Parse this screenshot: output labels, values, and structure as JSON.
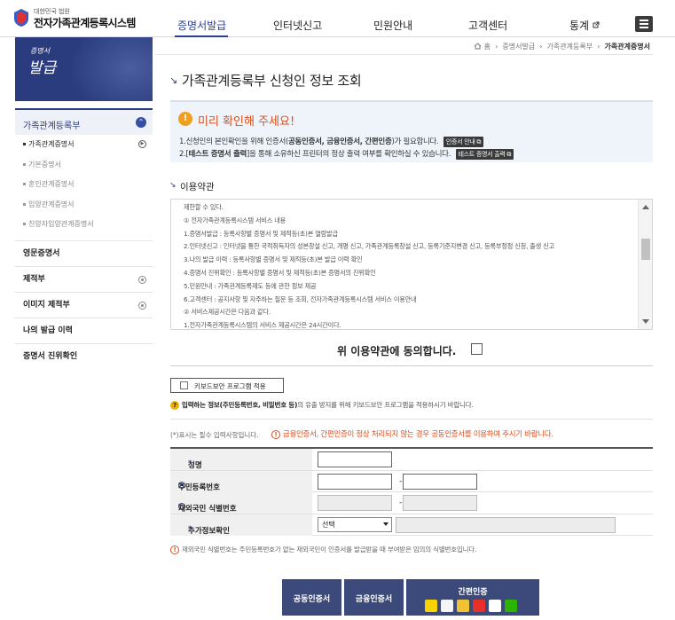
{
  "header": {
    "logo_sub": "대한민국 법원",
    "logo_main": "전자가족관계등록시스템",
    "nav": [
      {
        "label": "증명서발급"
      },
      {
        "label": "인터넷신고"
      },
      {
        "label": "민원안내"
      },
      {
        "label": "고객센터"
      },
      {
        "label": "통계"
      }
    ],
    "external_icon": "external-link-icon",
    "menu_icon": "hamburger-icon"
  },
  "breadcrumb": {
    "home": "홈",
    "level1": "증명서발급",
    "level2": "가족관계등록부",
    "current": "가족관계증명서"
  },
  "sidebar": {
    "banner_line1": "증명서",
    "banner_line2": "발급",
    "section_title": "가족관계등록부",
    "sub_items": [
      {
        "label": "가족관계증명서"
      },
      {
        "label": "기본증명서"
      },
      {
        "label": "혼인관계증명서"
      },
      {
        "label": "입양관계증명서"
      },
      {
        "label": "친양자입양관계증명서"
      }
    ],
    "items": [
      {
        "label": "영문증명서"
      },
      {
        "label": "제적부"
      },
      {
        "label": "이미지 제적부"
      },
      {
        "label": "나의 발급 이력"
      },
      {
        "label": "증명서 진위확인"
      }
    ]
  },
  "main": {
    "page_title": "가족관계등록부 신청인 정보 조회",
    "notice": {
      "title": "미리 확인해 주세요!",
      "line1_pre": "1.신청인의 본인확인을 위해 인증서(",
      "line1_bold": "공동인증서, 금융인증서, 간편인증",
      "line1_post": ")가 필요합니다.",
      "line1_btn": "인증서 안내",
      "line2_pre": "2.[",
      "line2_bold": "테스트 증명서 출력",
      "line2_post": "]을 통해 소유하신 프린터의 정상 출력 여부를 확인하실 수 있습니다.",
      "line2_btn": "테스트 증명서 출력"
    },
    "terms": {
      "title": "이용약관",
      "lines": [
        "제한할 수 있다.",
        "① 전자가족관계등록시스템 서비스 내용",
        "1.증명서발급 : 등록사항별 증명서 및 제적등(초)본 열람발급",
        "2.인터넷신고 : 인터넷을 통한 국적취득자의 성본창설 신고, 개명 신고, 가족관계등록창설 신고, 등록기준지변경 신고, 등록부정정 신청, 출생 신고",
        "3.나의 발급 이력 : 등록사항별 증명서 및 제적등(초)본 발급 이력 확인",
        "4.증명서 진위확인 : 등록사항별 증명서 및 제적등(초)본 증명서의 진위확인",
        "5.민원안내 : 가족관계등록제도 등에 관한 정보 제공",
        "6.고객센터 : 공지사항 및 자주하는 질문 등 조회, 전자가족관계등록시스템 서비스 이용안내",
        "② 서비스제공시간은 다음과 같다.",
        "1.전자가족관계등록시스템의 서비스 제공시간은 24시간이다."
      ]
    },
    "agree_label": "위 이용약관에 동의합니다.",
    "keyboard_btn": "키보드보안 프로그램 적용",
    "keyboard_note_bold": "입력하는 정보(주민등록번호, 비밀번호 등)",
    "keyboard_note_rest": "의 유출 방지를 위해 키보드보안 프로그램을 적용하시기 바랍니다.",
    "required_note": "(*)표시는 필수 입력사항입니다.",
    "cert_warning": "금융인증서, 간편인증이 정상 처리되지 않는 경우 공동인증서를 이용하여 주시기 바랍니다.",
    "form": {
      "name_label": "성명",
      "rrn_label": "주민등록번호",
      "foreign_label": "재외국민 식별번호",
      "extra_label": "추가정보확인",
      "required_mark": "*",
      "dash": "-",
      "select_value": "선택"
    },
    "foreign_note": "재외국민 식별번호는 주민등록번호가 없는 재외국민이 인증서를 발급받을 때 부여받은 임의의 식별번호입니다.",
    "buttons": {
      "joint_cert": "공동인증서",
      "financial_cert": "금융인증서",
      "simple_auth": "간편인증"
    },
    "simple_auth_providers": [
      {
        "name": "kakao-icon",
        "label": "kakao",
        "color": "#f7d400"
      },
      {
        "name": "pass-icon",
        "label": "PASS",
        "color": "#f5f5f5"
      },
      {
        "name": "bank-icon",
        "label": "KB",
        "color": "#f1c232"
      },
      {
        "name": "payco-icon",
        "label": "PAYCO",
        "color": "#e8302a"
      },
      {
        "name": "toss-icon",
        "label": "toss",
        "color": "#ffffff"
      },
      {
        "name": "naver-icon",
        "label": "N",
        "color": "#2db400"
      }
    ]
  },
  "colors": {
    "brand_navy": "#2a3c7e",
    "warning_orange": "#d94e1f",
    "button_navy": "#3b4a7a"
  }
}
